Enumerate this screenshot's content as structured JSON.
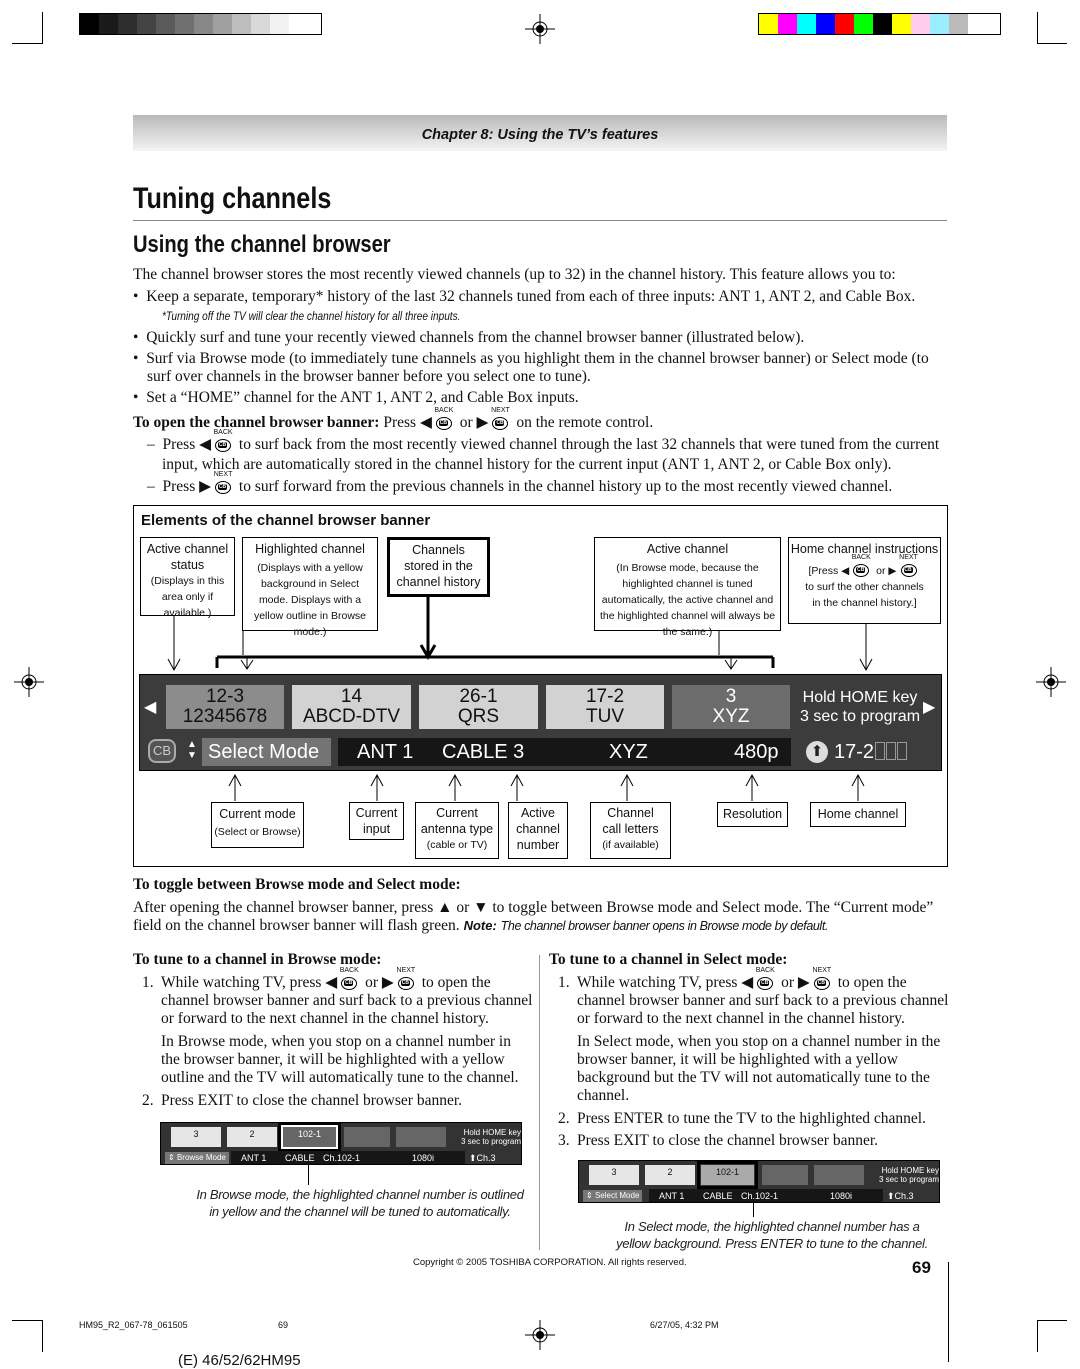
{
  "color_bars": {
    "grays": [
      "#000000",
      "#1a1a1a",
      "#2e2e2e",
      "#444444",
      "#5a5a5a",
      "#707070",
      "#888888",
      "#a0a0a0",
      "#bdbdbd",
      "#d9d9d9",
      "#f2f2f2",
      "#ffffff"
    ],
    "colors": [
      "#ffff00",
      "#ff00ff",
      "#00ffff",
      "#0000ff",
      "#ff0000",
      "#00ff00",
      "#000000",
      "#ffff00",
      "#ffccee",
      "#99eeff",
      "#bbbbbb"
    ]
  },
  "header": {
    "chapter": "Chapter 8: Using the TV’s features"
  },
  "title": "Tuning channels",
  "section": "Using the channel browser",
  "intro": "The channel browser stores the most recently viewed channels (up to 32) in the channel history. This feature allows you to:",
  "bullets": [
    "Keep a separate, temporary* history of the last 32 channels tuned from each of three inputs: ANT 1, ANT 2, and Cable Box.",
    "Quickly surf and tune your recently viewed channels from the channel browser banner (illustrated below).",
    "Surf via Browse mode (to immediately tune channels as you highlight them in the channel browser banner) or Select mode (to surf over channels in the browser banner before you select one to tune).",
    "Set a “HOME” channel for the ANT 1, ANT 2, and Cable Box inputs."
  ],
  "footnote": "*Turning off the TV will clear the channel history for all three inputs.",
  "keys": {
    "back": "BACK",
    "next": "NEXT",
    "cb": "CB"
  },
  "open": {
    "label": "To open the channel browser banner:",
    "press": "Press ◀",
    "or": "or ▶",
    "tail": "on the remote control."
  },
  "dashes": [
    {
      "pre": "Press ◀",
      "post": "to surf back from the most recently viewed channel through the last 32 channels that were tuned from the current",
      "cont": "input, which are automatically stored in the channel history for the current input (ANT 1, ANT 2, or Cable Box only)."
    },
    {
      "pre": "Press ▶",
      "post": "to surf forward from the previous channels in the channel history up to the most recently viewed channel."
    }
  ],
  "diagram": {
    "title": "Elements of the channel browser banner",
    "top_boxes": [
      {
        "title": "Active channel status",
        "note": "(Displays in this area only if available.)"
      },
      {
        "title": "Highlighted channel",
        "note": "(Displays with a yellow background in Select mode. Displays with a yellow outline in Browse mode.)"
      },
      {
        "title": "Channels stored in the channel history"
      },
      {
        "title": "Active channel",
        "note": "(In Browse mode, because the highlighted channel is tuned automatically, the active channel and the highlighted channel will always be the same.)"
      },
      {
        "title": "Home channel instructions",
        "note_pre": "[Press ◀",
        "note_or": "or ▶",
        "note_post": "to surf the other channels in the channel history.]"
      }
    ],
    "banner": {
      "tiles": [
        {
          "num": "12-3",
          "name": "12345678"
        },
        {
          "num": "14",
          "name": "ABCD-DTV"
        },
        {
          "num": "26-1",
          "name": "QRS"
        },
        {
          "num": "17-2",
          "name": "TUV"
        },
        {
          "num": "3",
          "name": "XYZ"
        }
      ],
      "home_hint": [
        "Hold HOME key",
        "3 sec to program"
      ],
      "cb": "CB",
      "mode": "Select Mode",
      "input": "ANT 1",
      "antenna": "CABLE 3",
      "call": "XYZ",
      "resolution": "480p",
      "home": "17-2"
    },
    "bottom_boxes": [
      {
        "title": "Current mode",
        "note": "(Select or Browse)"
      },
      {
        "title": "Current input"
      },
      {
        "title": "Current antenna type",
        "note": "(cable or TV)"
      },
      {
        "title": "Active channel number"
      },
      {
        "title": "Channel call letters",
        "note": "(if available)"
      },
      {
        "title": "Resolution"
      },
      {
        "title": "Home channel"
      }
    ]
  },
  "toggle": {
    "heading": "To toggle between Browse mode and Select mode:",
    "text": "After opening the channel browser banner, press ▲ or ▼ to toggle between Browse mode and Select mode. The “Current mode” field on the channel browser banner will flash green.",
    "note_label": "Note:",
    "note": "The channel browser banner opens in Browse mode by default."
  },
  "browse": {
    "heading": "To tune to a channel in Browse mode:",
    "step1_pre": "While watching TV, press ◀",
    "step1_or": "or ▶",
    "step1_post": "to open the channel browser banner and surf back to a previous channel or forward to the next channel in the channel history.",
    "para": "In Browse mode, when you stop on a channel number in the browser banner, it will be highlighted with a yellow outline and the TV will automatically tune to the channel.",
    "step2": "Press EXIT to close the channel browser banner.",
    "mini": {
      "tiles": [
        "3",
        "2",
        "102-1",
        "",
        ""
      ],
      "hint": [
        "Hold HOME key",
        "3 sec to program"
      ],
      "mode": "Browse Mode",
      "input": "ANT 1",
      "antenna": "CABLE",
      "channel": "Ch.102-1",
      "resolution": "1080i",
      "home": "Ch.3"
    },
    "caption": "In Browse mode, the highlighted channel number is outlined in yellow and the channel will be tuned to automatically."
  },
  "select": {
    "heading": "To tune to a channel in Select mode:",
    "step1_pre": "While watching TV, press ◀",
    "step1_or": "or ▶",
    "step1_post": "to open the channel browser banner and surf back to a previous channel or forward to the next channel in the channel history.",
    "para": "In Select mode, when you stop on a channel number in the browser banner, it will be highlighted with a yellow background but the TV will not automatically tune to the channel.",
    "step2": "Press ENTER to tune the TV to the highlighted channel.",
    "step3": "Press EXIT to close the channel browser banner.",
    "mini": {
      "tiles": [
        "3",
        "2",
        "102-1",
        "",
        ""
      ],
      "hint": [
        "Hold HOME key",
        "3 sec to program"
      ],
      "mode": "Select Mode",
      "input": "ANT 1",
      "antenna": "CABLE",
      "channel": "Ch.102-1",
      "resolution": "1080i",
      "home": "Ch.3"
    },
    "caption": "In Select mode, the highlighted channel number has a yellow background. Press ENTER to tune to the channel."
  },
  "copyright": "Copyright © 2005 TOSHIBA CORPORATION. All rights reserved.",
  "page_number": "69",
  "footer": {
    "file": "HM95_R2_067-78_061505",
    "page": "69",
    "date": "6/27/05, 4:32 PM",
    "model": "(E) 46/52/62HM95"
  }
}
